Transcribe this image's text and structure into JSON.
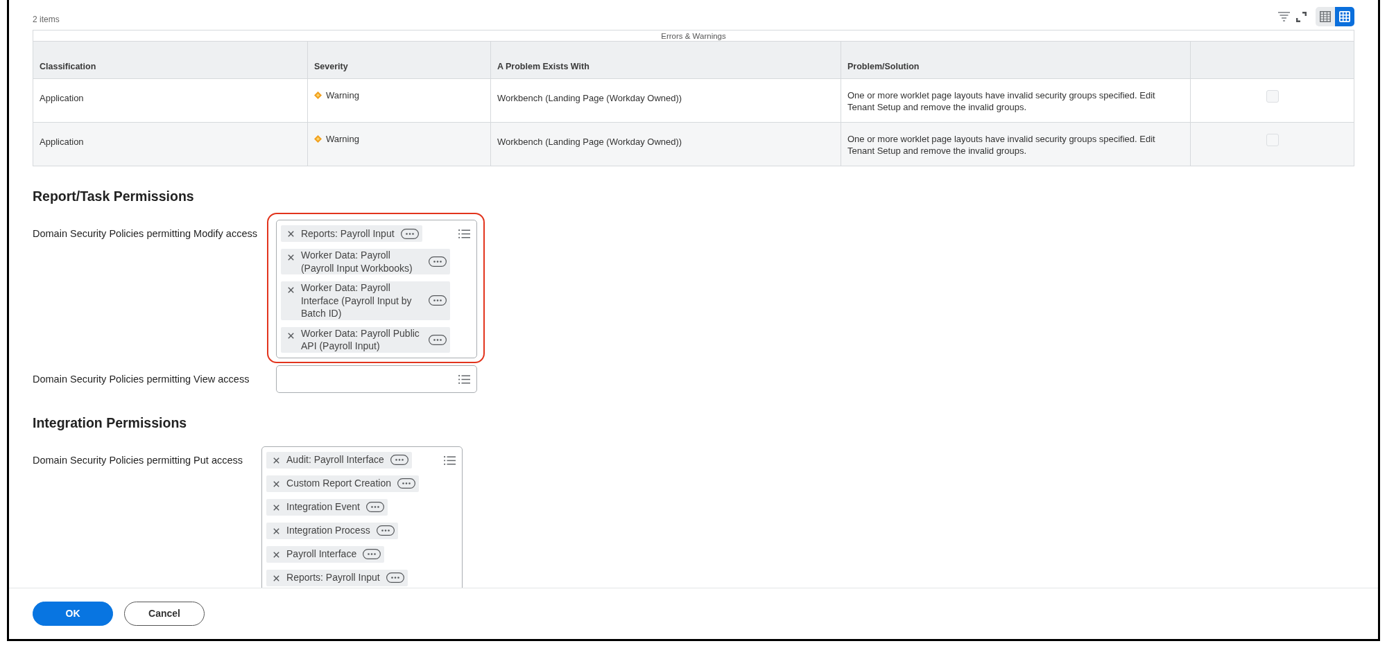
{
  "table": {
    "count": "2 items",
    "view_buttons": [
      {
        "kind": "table",
        "selected": false
      },
      {
        "kind": "grid",
        "selected": true
      }
    ],
    "title": "Errors & Warnings",
    "columns": [
      "Classification",
      "Severity",
      "A Problem Exists With",
      "Problem/Solution"
    ],
    "rows": [
      {
        "classification": "Application",
        "severity": "Warning",
        "problem_exists_with": "Workbench (Landing Page (Workday Owned))",
        "problem_solution": "One or more worklet page layouts have invalid security groups specified. Edit Tenant Setup and remove the invalid groups.",
        "checked": false
      },
      {
        "classification": "Application",
        "severity": "Warning",
        "problem_exists_with": "Workbench (Landing Page (Workday Owned))",
        "problem_solution": "One or more worklet page layouts have invalid security groups specified. Edit Tenant Setup and remove the invalid groups.",
        "checked": false
      }
    ]
  },
  "sections": [
    {
      "title": "Report/Task Permissions",
      "fields": [
        {
          "label": "Domain Security Policies permitting Modify access",
          "highlighted": true,
          "values": [
            "Reports: Payroll Input",
            "Worker Data: Payroll (Payroll Input Workbooks)",
            "Worker Data: Payroll Interface (Payroll Input by Batch ID)",
            "Worker Data: Payroll Public API (Payroll Input)"
          ]
        },
        {
          "label": "Domain Security Policies permitting View access",
          "highlighted": false
        }
      ]
    },
    {
      "title": "Integration Permissions",
      "fields": [
        {
          "label": "Domain Security Policies permitting Put access",
          "highlighted": false,
          "values": [
            "Audit: Payroll Interface",
            "Custom Report Creation",
            "Integration Event",
            "Integration Process",
            "Payroll Interface",
            "Reports: Payroll Input"
          ]
        }
      ]
    }
  ],
  "buttons": [
    {
      "label": "OK",
      "kind": "primary"
    },
    {
      "label": "Cancel",
      "kind": "secondary"
    }
  ]
}
